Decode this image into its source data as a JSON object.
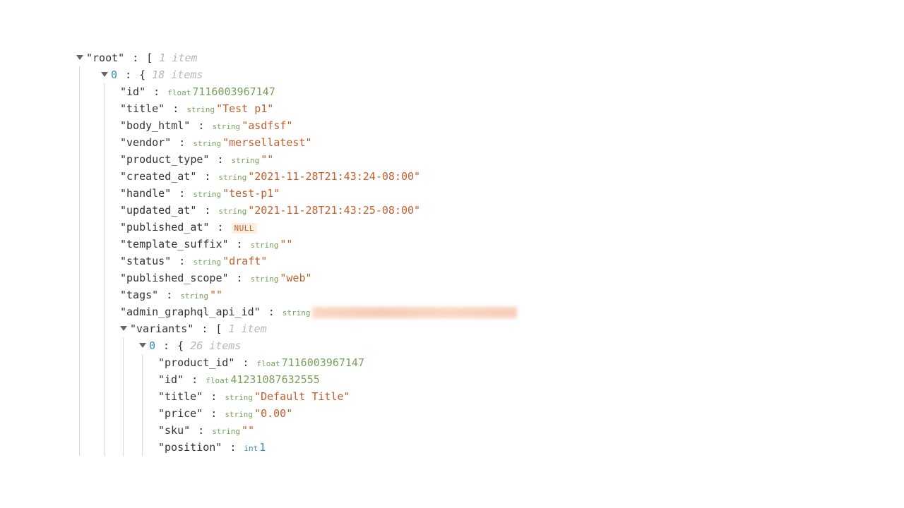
{
  "root": {
    "label": "\"root\"",
    "open": "[",
    "meta": "1 item",
    "items": [
      {
        "idx": "0",
        "open": "{",
        "meta": "18 items",
        "props": [
          {
            "key": "\"id\"",
            "type": "float",
            "typeClass": "float",
            "val": "7116003967147",
            "valClass": "val-num"
          },
          {
            "key": "\"title\"",
            "type": "string",
            "typeClass": "str",
            "val": "\"Test p1\"",
            "valClass": "val-str"
          },
          {
            "key": "\"body_html\"",
            "type": "string",
            "typeClass": "str",
            "val": "\"asdfsf\"",
            "valClass": "val-str"
          },
          {
            "key": "\"vendor\"",
            "type": "string",
            "typeClass": "str",
            "val": "\"mersellatest\"",
            "valClass": "val-str"
          },
          {
            "key": "\"product_type\"",
            "type": "string",
            "typeClass": "str",
            "val": "\"\"",
            "valClass": "val-str"
          },
          {
            "key": "\"created_at\"",
            "type": "string",
            "typeClass": "str",
            "val": "\"2021-11-28T21:43:24-08:00\"",
            "valClass": "val-str"
          },
          {
            "key": "\"handle\"",
            "type": "string",
            "typeClass": "str",
            "val": "\"test-p1\"",
            "valClass": "val-str"
          },
          {
            "key": "\"updated_at\"",
            "type": "string",
            "typeClass": "str",
            "val": "\"2021-11-28T21:43:25-08:00\"",
            "valClass": "val-str"
          },
          {
            "key": "\"published_at\"",
            "null": "NULL"
          },
          {
            "key": "\"template_suffix\"",
            "type": "string",
            "typeClass": "str",
            "val": "\"\"",
            "valClass": "val-str"
          },
          {
            "key": "\"status\"",
            "type": "string",
            "typeClass": "str",
            "val": "\"draft\"",
            "valClass": "val-str"
          },
          {
            "key": "\"published_scope\"",
            "type": "string",
            "typeClass": "str",
            "val": "\"web\"",
            "valClass": "val-str"
          },
          {
            "key": "\"tags\"",
            "type": "string",
            "typeClass": "str",
            "val": "\"\"",
            "valClass": "val-str"
          },
          {
            "key": "\"admin_graphql_api_id\"",
            "type": "string",
            "typeClass": "str",
            "blur": true
          }
        ],
        "variants": {
          "key": "\"variants\"",
          "open": "[",
          "meta": "1 item",
          "items": [
            {
              "idx": "0",
              "open": "{",
              "meta": "26 items",
              "props": [
                {
                  "key": "\"product_id\"",
                  "type": "float",
                  "typeClass": "float",
                  "val": "7116003967147",
                  "valClass": "val-num"
                },
                {
                  "key": "\"id\"",
                  "type": "float",
                  "typeClass": "float",
                  "val": "41231087632555",
                  "valClass": "val-num"
                },
                {
                  "key": "\"title\"",
                  "type": "string",
                  "typeClass": "str",
                  "val": "\"Default Title\"",
                  "valClass": "val-str"
                },
                {
                  "key": "\"price\"",
                  "type": "string",
                  "typeClass": "str",
                  "val": "\"0.00\"",
                  "valClass": "val-str"
                },
                {
                  "key": "\"sku\"",
                  "type": "string",
                  "typeClass": "str",
                  "val": "\"\"",
                  "valClass": "val-str"
                },
                {
                  "key": "\"position\"",
                  "type": "int",
                  "typeClass": "int",
                  "val": "1",
                  "valClass": "val-int"
                }
              ]
            }
          ]
        }
      }
    ]
  }
}
